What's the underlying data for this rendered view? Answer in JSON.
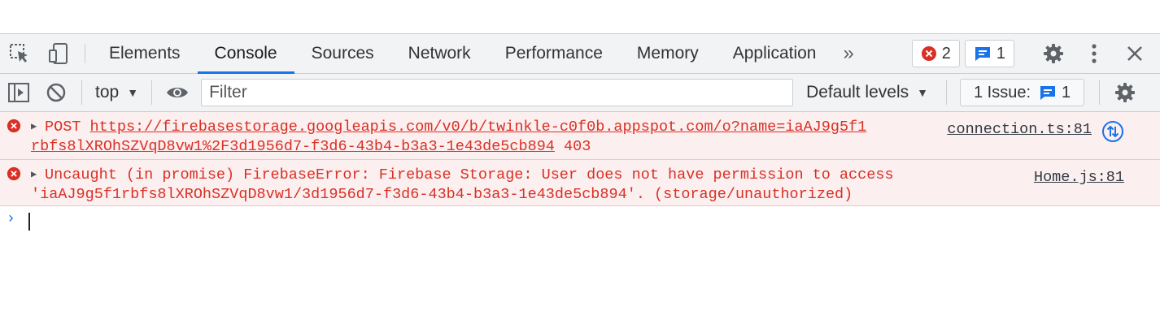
{
  "tabs": [
    "Elements",
    "Console",
    "Sources",
    "Network",
    "Performance",
    "Memory",
    "Application"
  ],
  "active_tab": "Console",
  "more_tabs_glyph": "»",
  "error_count": "2",
  "message_count": "1",
  "toolbar": {
    "context": "top",
    "filter_placeholder": "Filter",
    "levels": "Default levels",
    "issues_label": "1 Issue:",
    "issues_count": "1"
  },
  "messages": [
    {
      "method": "POST",
      "url_line1": "https://firebasestorage.googleapis.com/v0/b/twinkle-c0f0b.appspot.com/o?name=iaAJ9g5f1",
      "url_line2": "rbfs8lXROhSZVqD8vw1%2F3d1956d7-f3d6-43b4-b3a3-1e43de5cb894",
      "status": "403",
      "source": "connection.ts:81"
    },
    {
      "line1": "Uncaught (in promise) FirebaseError: Firebase Storage: User does not have permission to access",
      "line2": "'iaAJ9g5f1rbfs8lXROhSZVqD8vw1/3d1956d7-f3d6-43b4-b3a3-1e43de5cb894'. (storage/unauthorized)",
      "source": "Home.js:81"
    }
  ],
  "prompt_glyph": "›",
  "colors": {
    "accent": "#1a73e8",
    "error": "#d93025",
    "error_bg": "#fcefef"
  }
}
